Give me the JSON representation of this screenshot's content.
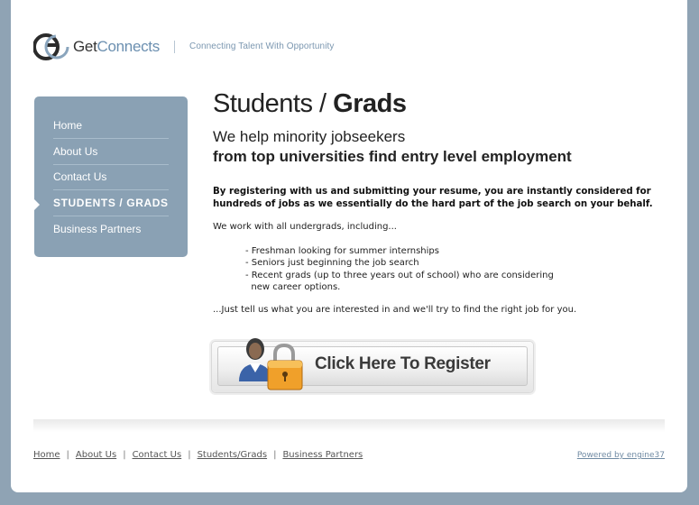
{
  "header": {
    "logo_left": "Get",
    "logo_right": "Connects",
    "tagline": "Connecting Talent With Opportunity"
  },
  "sidebar": {
    "items": [
      {
        "label": "Home"
      },
      {
        "label": "About Us"
      },
      {
        "label": "Contact Us"
      },
      {
        "label": "STUDENTS / GRADS",
        "active": true
      },
      {
        "label": "Business Partners"
      }
    ]
  },
  "main": {
    "title_light": "Students / ",
    "title_bold": "Grads",
    "subtitle_1": "We help minority jobseekers",
    "subtitle_2": "from top universities find entry level employment",
    "intro": "By registering with us and submitting your resume, you are instantly considered for hundreds of jobs as we essentially do the hard part of the job search on your behalf.",
    "lead": "We work with all undergrads, including...",
    "bullets": [
      "- Freshman looking for summer internships",
      "- Seniors just beginning the job search",
      "- Recent grads (up to three years out of school) who are considering",
      "  new career options."
    ],
    "closing": "...Just tell us what you are interested in and we'll try to find the right job for you.",
    "register_label": "Click Here To Register",
    "register_icon": "user-lock-icon"
  },
  "footer": {
    "links": [
      "Home",
      "About Us",
      "Contact Us",
      "Students/Grads",
      "Business Partners"
    ],
    "separator": "|",
    "powered": "Powered by engine37"
  },
  "colors": {
    "background": "#8fa3b4",
    "sidebar": "#8aa1b4",
    "accent": "#6b8fb0",
    "lock": "#f0a02a"
  }
}
